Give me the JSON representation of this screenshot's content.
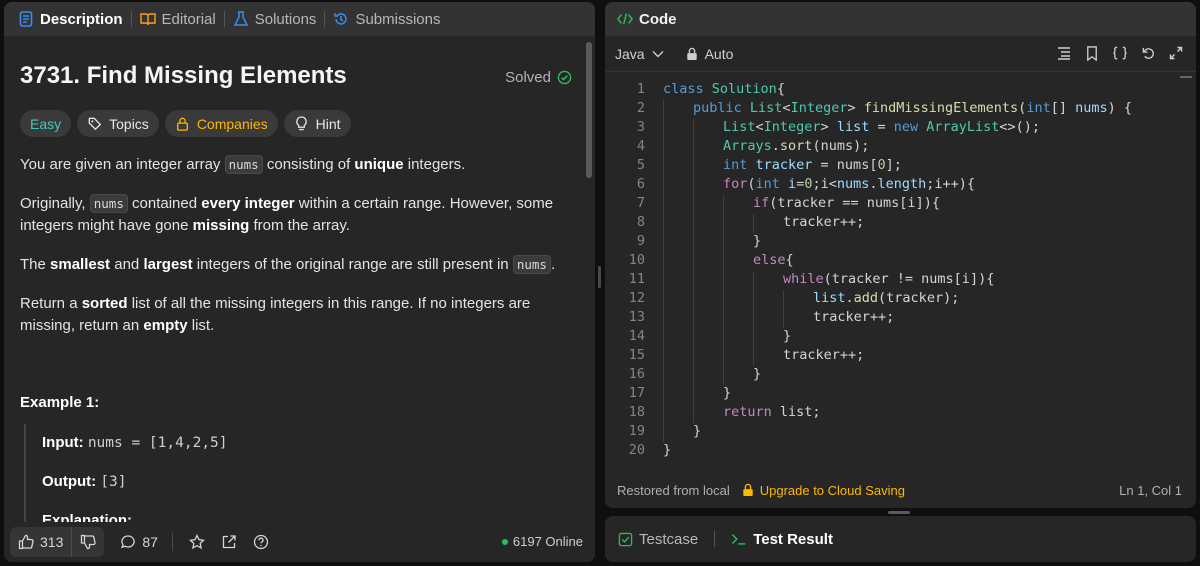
{
  "left_panel": {
    "tabs": [
      {
        "label": "Description",
        "icon": "description-icon",
        "active": true
      },
      {
        "label": "Editorial",
        "icon": "book-icon",
        "active": false
      },
      {
        "label": "Solutions",
        "icon": "flask-icon",
        "active": false
      },
      {
        "label": "Submissions",
        "icon": "history-icon",
        "active": false
      }
    ],
    "problem_title": "3731. Find Missing Elements",
    "solved_label": "Solved",
    "chips": {
      "difficulty": "Easy",
      "topics": "Topics",
      "companies": "Companies",
      "hint": "Hint"
    },
    "description": {
      "p1_a": "You are given an integer array ",
      "p1_code": "nums",
      "p1_b": " consisting of ",
      "p1_bold": "unique",
      "p1_c": " integers.",
      "p2_a": "Originally, ",
      "p2_code": "nums",
      "p2_b": " contained ",
      "p2_bold": "every integer",
      "p2_c": " within a certain range. However, some integers might have gone ",
      "p2_bold2": "missing",
      "p2_d": " from the array.",
      "p3_a": "The ",
      "p3_bold1": "smallest",
      "p3_b": " and ",
      "p3_bold2": "largest",
      "p3_c": " integers of the original range are still present in ",
      "p3_code": "nums",
      "p3_d": ".",
      "p4_a": "Return a ",
      "p4_bold1": "sorted",
      "p4_b": " list of all the missing integers in this range. If no integers are missing, return an ",
      "p4_bold2": "empty",
      "p4_c": " list."
    },
    "example": {
      "title": "Example 1:",
      "input_label": "Input:",
      "input_value": "nums = [1,4,2,5]",
      "output_label": "Output:",
      "output_value": "[3]",
      "explanation_label": "Explanation:"
    },
    "footer": {
      "likes": "313",
      "comments": "87",
      "online": "6197 Online"
    }
  },
  "code_panel": {
    "title": "Code",
    "language": "Java",
    "mode": "Auto",
    "lines": [
      {
        "n": "1",
        "indent": 0,
        "segs": [
          [
            "kb",
            "class "
          ],
          [
            "ty",
            "Solution"
          ],
          [
            "",
            "{"
          ]
        ]
      },
      {
        "n": "2",
        "indent": 1,
        "segs": [
          [
            "kb",
            "public "
          ],
          [
            "ty",
            "List"
          ],
          [
            "",
            "<"
          ],
          [
            "ty",
            "Integer"
          ],
          [
            "",
            "> "
          ],
          [
            "fn",
            "findMissingElements"
          ],
          [
            "",
            "("
          ],
          [
            "kb",
            "int"
          ],
          [
            "",
            "[] "
          ],
          [
            "vr",
            "nums"
          ],
          [
            "",
            ") {"
          ]
        ]
      },
      {
        "n": "3",
        "indent": 2,
        "segs": [
          [
            "ty",
            "List"
          ],
          [
            "",
            "<"
          ],
          [
            "ty",
            "Integer"
          ],
          [
            "",
            "> "
          ],
          [
            "vr",
            "list"
          ],
          [
            "",
            " = "
          ],
          [
            "kb",
            "new "
          ],
          [
            "ty",
            "ArrayList"
          ],
          [
            "",
            "<>();"
          ]
        ]
      },
      {
        "n": "4",
        "indent": 2,
        "segs": [
          [
            "ty",
            "Arrays"
          ],
          [
            "",
            "."
          ],
          [
            "fn",
            "sort"
          ],
          [
            "",
            "(nums);"
          ]
        ]
      },
      {
        "n": "5",
        "indent": 2,
        "segs": [
          [
            "kb",
            "int "
          ],
          [
            "vr",
            "tracker"
          ],
          [
            "",
            " = nums["
          ],
          [
            "nm",
            "0"
          ],
          [
            "",
            "];"
          ]
        ]
      },
      {
        "n": "6",
        "indent": 2,
        "segs": [
          [
            "kw",
            "for"
          ],
          [
            "",
            "("
          ],
          [
            "kb",
            "int "
          ],
          [
            "vr",
            "i"
          ],
          [
            "",
            "="
          ],
          [
            "nm",
            "0"
          ],
          [
            "",
            ";i<"
          ],
          [
            "vr",
            "nums"
          ],
          [
            "",
            "."
          ],
          [
            "vr",
            "length"
          ],
          [
            "",
            ";i++){"
          ]
        ]
      },
      {
        "n": "7",
        "indent": 3,
        "segs": [
          [
            "kw",
            "if"
          ],
          [
            "",
            "(tracker == nums[i]){"
          ]
        ]
      },
      {
        "n": "8",
        "indent": 4,
        "segs": [
          [
            "",
            "tracker++;"
          ]
        ]
      },
      {
        "n": "9",
        "indent": 3,
        "segs": [
          [
            "",
            "}"
          ]
        ]
      },
      {
        "n": "10",
        "indent": 3,
        "segs": [
          [
            "kw",
            "else"
          ],
          [
            "",
            "{"
          ]
        ]
      },
      {
        "n": "11",
        "indent": 4,
        "segs": [
          [
            "kw",
            "while"
          ],
          [
            "",
            "(tracker != nums[i]){"
          ]
        ]
      },
      {
        "n": "12",
        "indent": 5,
        "segs": [
          [
            "vr",
            "list"
          ],
          [
            "",
            "."
          ],
          [
            "fn",
            "add"
          ],
          [
            "",
            "(tracker);"
          ]
        ]
      },
      {
        "n": "13",
        "indent": 5,
        "segs": [
          [
            "",
            "tracker++;"
          ]
        ]
      },
      {
        "n": "14",
        "indent": 4,
        "segs": [
          [
            "",
            "}"
          ]
        ]
      },
      {
        "n": "15",
        "indent": 4,
        "segs": [
          [
            "",
            "tracker++;"
          ]
        ]
      },
      {
        "n": "16",
        "indent": 3,
        "segs": [
          [
            "",
            "}"
          ]
        ]
      },
      {
        "n": "17",
        "indent": 2,
        "segs": [
          [
            "",
            "}"
          ]
        ]
      },
      {
        "n": "18",
        "indent": 2,
        "segs": [
          [
            "kw",
            "return "
          ],
          [
            "",
            "list;"
          ]
        ]
      },
      {
        "n": "19",
        "indent": 1,
        "segs": [
          [
            "",
            "}"
          ]
        ]
      },
      {
        "n": "20",
        "indent": 0,
        "segs": [
          [
            "",
            "}"
          ]
        ]
      }
    ],
    "status": {
      "restored": "Restored from local",
      "upgrade": "Upgrade to Cloud Saving",
      "position": "Ln 1, Col 1"
    }
  },
  "bottom_panel": {
    "tabs": [
      {
        "label": "Testcase",
        "active": false
      },
      {
        "label": "Test Result",
        "active": true
      }
    ]
  }
}
